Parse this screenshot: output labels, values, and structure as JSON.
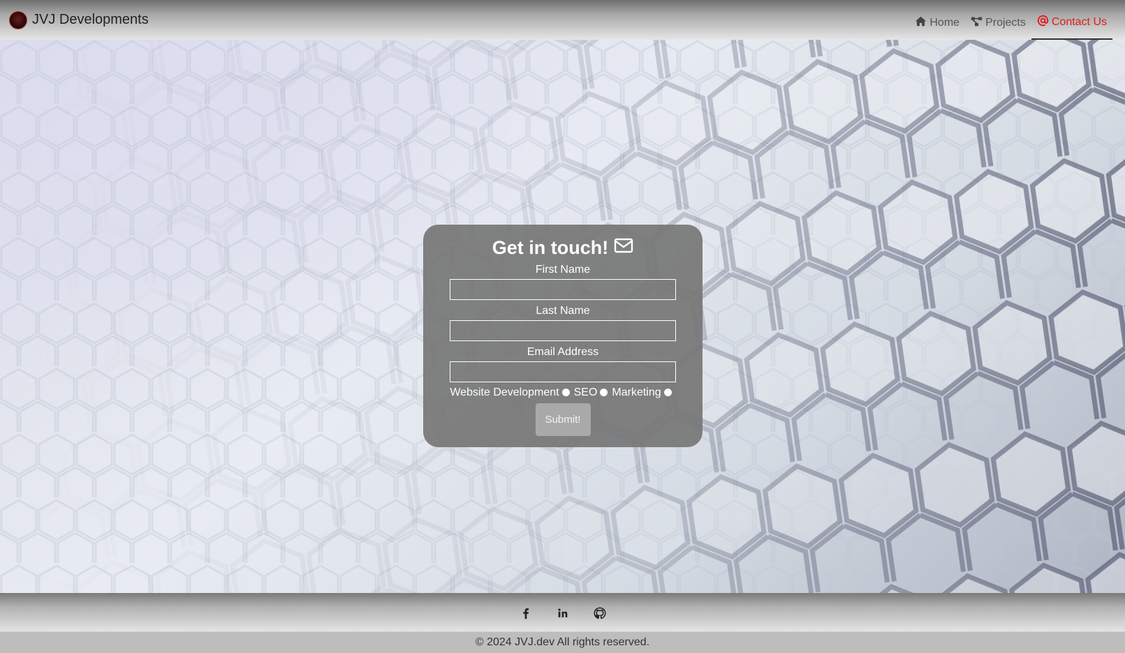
{
  "navbar": {
    "brand": "JVJ Developments",
    "links": [
      {
        "label": "Home",
        "icon": "home-icon",
        "active": false
      },
      {
        "label": "Projects",
        "icon": "network-icon",
        "active": false
      },
      {
        "label": "Contact Us",
        "icon": "at-icon",
        "active": true
      }
    ],
    "active_color": "#e01b1b"
  },
  "contact_form": {
    "title": "Get in touch!",
    "title_icon": "envelope-icon",
    "fields": [
      {
        "label": "First Name",
        "value": "",
        "placeholder": ""
      },
      {
        "label": "Last Name",
        "value": "",
        "placeholder": ""
      },
      {
        "label": "Email Address",
        "value": "",
        "placeholder": ""
      }
    ],
    "services": [
      "Website Development",
      "SEO",
      "Marketing"
    ],
    "submit_label": "Submit!"
  },
  "footer": {
    "social": [
      "facebook-icon",
      "linkedin-icon",
      "github-icon"
    ],
    "copyright": "© 2024 JVJ.dev All rights reserved."
  }
}
